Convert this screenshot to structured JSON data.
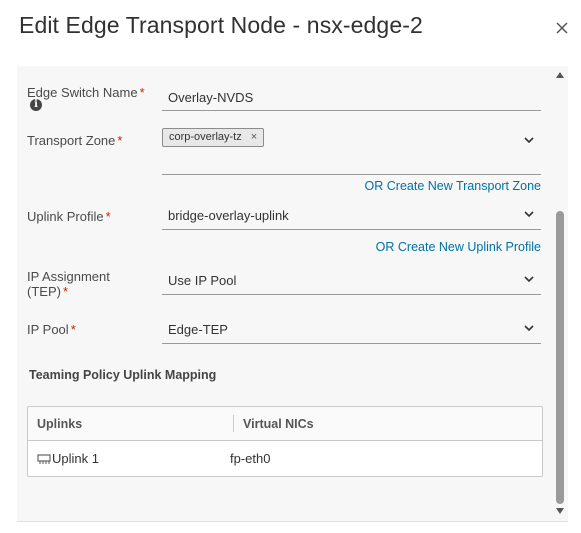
{
  "dialog": {
    "title": "Edit Edge Transport Node - nsx-edge-2"
  },
  "form": {
    "edge_switch": {
      "label": "Edge Switch Name",
      "required_mark": "*",
      "value": "Overlay-NVDS"
    },
    "transport_zone": {
      "label": "Transport Zone",
      "required_mark": "*",
      "chip": "corp-overlay-tz",
      "chip_remove": "×",
      "create_link": "OR Create New Transport Zone"
    },
    "uplink_profile": {
      "label": "Uplink Profile",
      "required_mark": "*",
      "value": "bridge-overlay-uplink",
      "create_link": "OR Create New Uplink Profile"
    },
    "ip_assignment": {
      "label_line1": "IP Assignment",
      "label_line2": "(TEP)",
      "required_mark": "*",
      "value": "Use IP Pool"
    },
    "ip_pool": {
      "label": "IP Pool",
      "required_mark": "*",
      "value": "Edge-TEP"
    }
  },
  "teaming": {
    "title": "Teaming Policy Uplink Mapping",
    "columns": [
      "Uplinks",
      "Virtual NICs"
    ],
    "rows": [
      {
        "uplink": "Uplink 1",
        "vnic": "fp-eth0"
      }
    ]
  },
  "icons": {
    "close": "close-icon",
    "info": "info-icon",
    "chevron": "chevron-down-icon",
    "uplink": "uplink-icon"
  },
  "colors": {
    "link": "#0072a3",
    "required": "#c92100",
    "panel_bg": "#f7f7f7"
  }
}
